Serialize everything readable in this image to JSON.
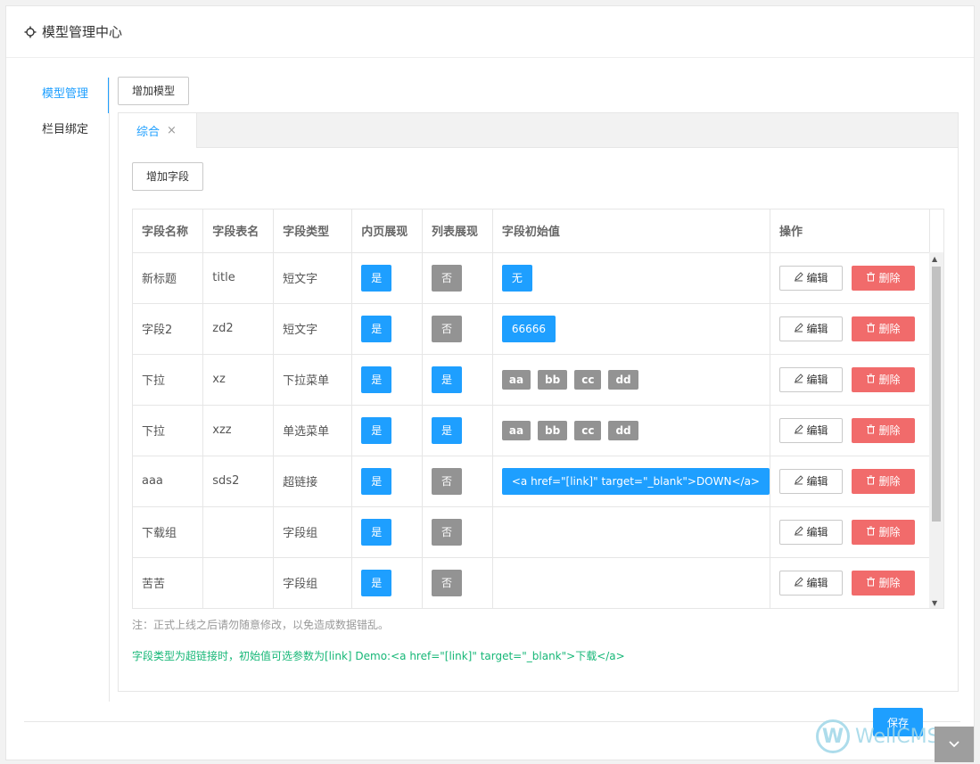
{
  "header": {
    "title": "模型管理中心",
    "icon": "gear-icon"
  },
  "sidebar": {
    "items": [
      {
        "label": "模型管理",
        "active": true
      },
      {
        "label": "栏目绑定",
        "active": false
      }
    ]
  },
  "toolbar": {
    "add_model_label": "增加模型"
  },
  "tabs": [
    {
      "label": "综合",
      "close": "×"
    }
  ],
  "fields": {
    "add_field_label": "增加字段"
  },
  "table": {
    "columns": [
      "字段名称",
      "字段表名",
      "字段类型",
      "内页展现",
      "列表展现",
      "字段初始值",
      "操作"
    ],
    "edit_label": "编辑",
    "delete_label": "删除",
    "rows": [
      {
        "name": "新标题",
        "table_name": "title",
        "type": "短文字",
        "page_show": "是",
        "list_show": "否",
        "init": "无",
        "init_kind": "badge"
      },
      {
        "name": "字段2",
        "table_name": "zd2",
        "type": "短文字",
        "page_show": "是",
        "list_show": "否",
        "init": "66666",
        "init_kind": "badge"
      },
      {
        "name": "下拉",
        "table_name": "xz",
        "type": "下拉菜单",
        "page_show": "是",
        "list_show": "是",
        "init_options": [
          "aa",
          "bb",
          "cc",
          "dd"
        ],
        "init_kind": "options"
      },
      {
        "name": "下拉",
        "table_name": "xzz",
        "type": "单选菜单",
        "page_show": "是",
        "list_show": "是",
        "init_options": [
          "aa",
          "bb",
          "cc",
          "dd"
        ],
        "init_kind": "options"
      },
      {
        "name": "aaa",
        "table_name": "sds2",
        "type": "超链接",
        "page_show": "是",
        "list_show": "否",
        "init": "<a href=\"[link]\" target=\"_blank\">DOWN</a>",
        "init_kind": "badge"
      },
      {
        "name": "下载组",
        "table_name": "",
        "type": "字段组",
        "page_show": "是",
        "list_show": "否",
        "init_kind": "none"
      },
      {
        "name": "苦苦",
        "table_name": "",
        "type": "字段组",
        "page_show": "是",
        "list_show": "否",
        "init_kind": "none"
      }
    ]
  },
  "notes": {
    "warning": "注：正式上线之后请勿随意修改，以免造成数据错乱。",
    "tip": "字段类型为超链接时，初始值可选参数为[link] Demo:<a href=\"[link]\" target=\"_blank\">下载</a>"
  },
  "footer": {
    "save_label": "保存"
  },
  "watermark": {
    "text": "WellCMS.cn"
  },
  "colors": {
    "accent": "#1e9fff",
    "gray_badge": "#939393",
    "danger": "#f16b6b",
    "tip": "#16b777"
  }
}
